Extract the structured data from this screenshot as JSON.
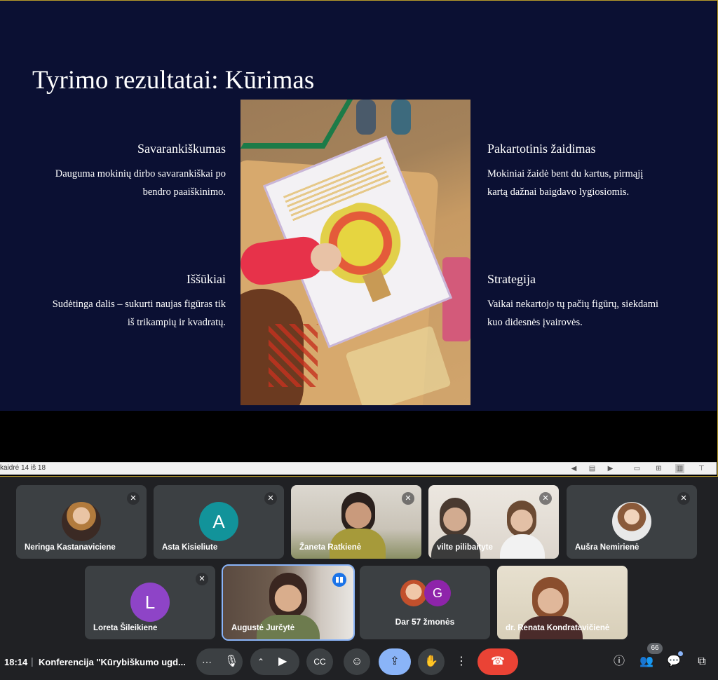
{
  "slide": {
    "title": "Tyrimo rezultatai: Kūrimas",
    "blocks": [
      {
        "heading": "Savarankiškumas",
        "line1": "Dauguma mokinių dirbo savarankiškai po",
        "line2": "bendro paaiškinimo."
      },
      {
        "heading": "Iššūkiai",
        "line1": "Sudėtinga dalis – sukurti naujas figūras tik",
        "line2": "iš trikampių ir kvadratų."
      },
      {
        "heading": "Pakartotinis žaidimas",
        "line1": "Mokiniai žaidė bent du kartus, pirmąjį",
        "line2": "kartą dažnai baigdavo lygiosiomis."
      },
      {
        "heading": "Strategija",
        "line1": "Vaikai nekartojo tų pačių figūrų, siekdami",
        "line2": "kuo didesnės įvairovės."
      }
    ]
  },
  "viewer": {
    "slide_counter": "kaidrė 14 iš 18"
  },
  "participants": {
    "p1": {
      "name": "Neringa Kastanaviciene"
    },
    "p2": {
      "name": "Asta Kisieliute",
      "initial": "A",
      "color": "#12939a"
    },
    "p3": {
      "name": "Žaneta Ratkienė"
    },
    "p4": {
      "name": "vilte pilibaityte"
    },
    "p5": {
      "name": "Aušra Nemirienė"
    },
    "p6": {
      "name": "Loreta Šileikiene",
      "initial": "L",
      "color": "#8e44c7"
    },
    "p7": {
      "name": "Augustė Jurčytė"
    },
    "p8": {
      "label": "Dar 57 žmonės",
      "initial": "G",
      "color": "#8e24aa"
    },
    "p9": {
      "name": "dr. Renata Kondratavičienė"
    }
  },
  "bottom": {
    "time": "18:14",
    "separator": "|",
    "meeting_title": "Konferencija \"Kūrybiškumo ugd...",
    "people_count": "66"
  },
  "icons": {
    "mic_off": "mic-off-icon",
    "more": "more-options-icon",
    "mic": "mic-icon",
    "camera": "camera-icon",
    "captions": "captions-icon",
    "emoji": "emoji-icon",
    "present": "present-screen-icon",
    "raise_hand": "raise-hand-icon",
    "leave": "leave-call-icon",
    "info": "info-icon",
    "people": "people-icon",
    "chat": "chat-icon",
    "activities": "activities-icon"
  }
}
